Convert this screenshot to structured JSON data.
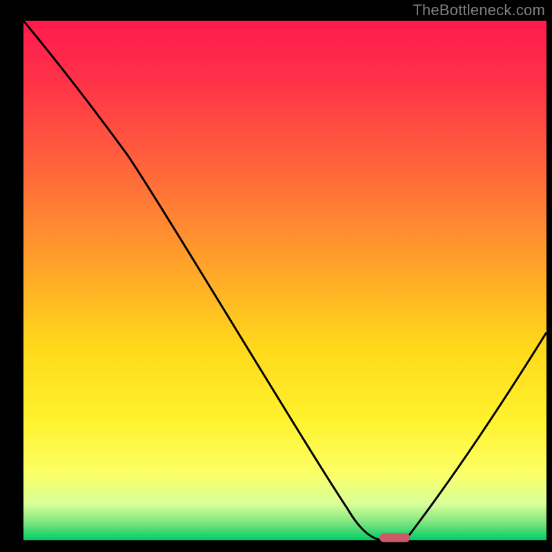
{
  "watermark": "TheBottleneck.com",
  "chart_data": {
    "type": "line",
    "title": "",
    "xlabel": "",
    "ylabel": "",
    "xlim": [
      0,
      100
    ],
    "ylim": [
      0,
      100
    ],
    "grid": false,
    "legend": false,
    "series": [
      {
        "name": "bottleneck-curve",
        "x": [
          0,
          20,
          62,
          69,
          73,
          100
        ],
        "values": [
          100,
          74,
          6,
          0,
          0,
          40
        ]
      }
    ],
    "marker": {
      "name": "optimal-point",
      "x": 71,
      "y": 0.5,
      "color": "#cc5a66"
    },
    "background_gradient": {
      "stops": [
        {
          "offset": 0.0,
          "color": "#ff1a4d"
        },
        {
          "offset": 0.12,
          "color": "#ff3348"
        },
        {
          "offset": 0.3,
          "color": "#ff6a3a"
        },
        {
          "offset": 0.48,
          "color": "#ffa629"
        },
        {
          "offset": 0.63,
          "color": "#ffd91a"
        },
        {
          "offset": 0.77,
          "color": "#fff22e"
        },
        {
          "offset": 0.87,
          "color": "#fcff66"
        },
        {
          "offset": 0.93,
          "color": "#d9ff99"
        },
        {
          "offset": 0.965,
          "color": "#80e680"
        },
        {
          "offset": 1.0,
          "color": "#00cc66"
        }
      ]
    }
  }
}
